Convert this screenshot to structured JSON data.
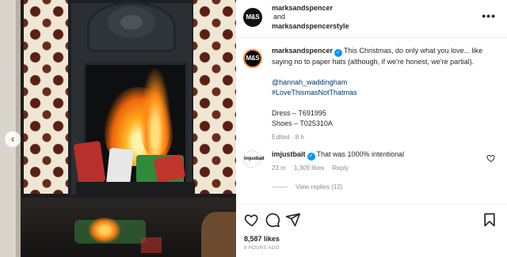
{
  "header": {
    "user_primary": "marksandspencer",
    "conjunction": "and",
    "user_secondary": "marksandspencerstyle",
    "avatar_text": "M&S",
    "more_label": "•••"
  },
  "media": {
    "prev_label": "‹"
  },
  "caption": {
    "avatar_text": "M&S",
    "username": "marksandspencer",
    "text": "This Christmas, do only what you love... like saying no to paper hats (although, if we're honest, we're partial).",
    "mention": "@hannah_waddingham",
    "hashtag": "#LoveThismasNotThatmas",
    "dress": "Dress – T691995",
    "shoes": "Shoes – T025310A",
    "edited": "Edited · 8 h"
  },
  "comment": {
    "avatar_text": "imjustbait",
    "username": "imjustbait",
    "text": "That was 1000% intentional",
    "time": "23 m",
    "likes": "1,309 likes",
    "reply": "Reply",
    "view_replies": "View replies (12)"
  },
  "footer": {
    "likes": "8,587 likes",
    "time_ago": "8 HOURS AGO"
  },
  "colors": {
    "verified": "#0095f6",
    "link": "#00376b",
    "muted": "#8e8e8e"
  }
}
